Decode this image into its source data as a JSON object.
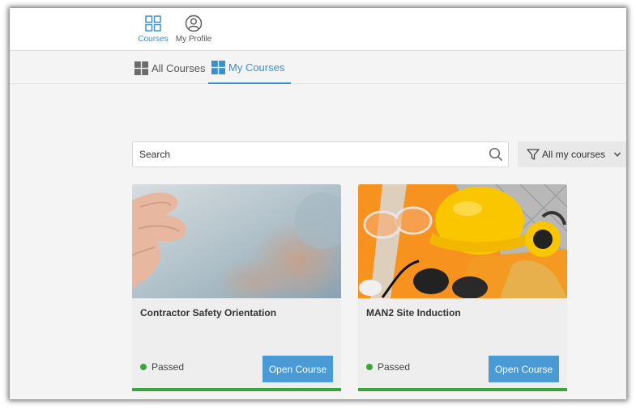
{
  "topnav": {
    "items": [
      {
        "label": "Courses",
        "icon": "grid-icon",
        "active": true
      },
      {
        "label": "My Profile",
        "icon": "user-circle-icon",
        "active": false
      }
    ]
  },
  "tabs": [
    {
      "label": "All Courses",
      "icon": "grid-squares-icon",
      "active": false
    },
    {
      "label": "My Courses",
      "icon": "grid-squares-icon",
      "active": true
    }
  ],
  "search": {
    "placeholder": "Search",
    "value": ""
  },
  "filter": {
    "label": "All my courses"
  },
  "courses": [
    {
      "title": "Contractor Safety Orientation",
      "status": "Passed",
      "button": "Open Course",
      "progress": 1.0
    },
    {
      "title": "MAN2 Site Induction",
      "status": "Passed",
      "button": "Open Course",
      "progress": 1.0
    }
  ],
  "colors": {
    "accent": "#3a8fd0",
    "button": "#4a9ad6",
    "passed": "#3aa53a",
    "tab_icon": "#6b6b6b"
  }
}
